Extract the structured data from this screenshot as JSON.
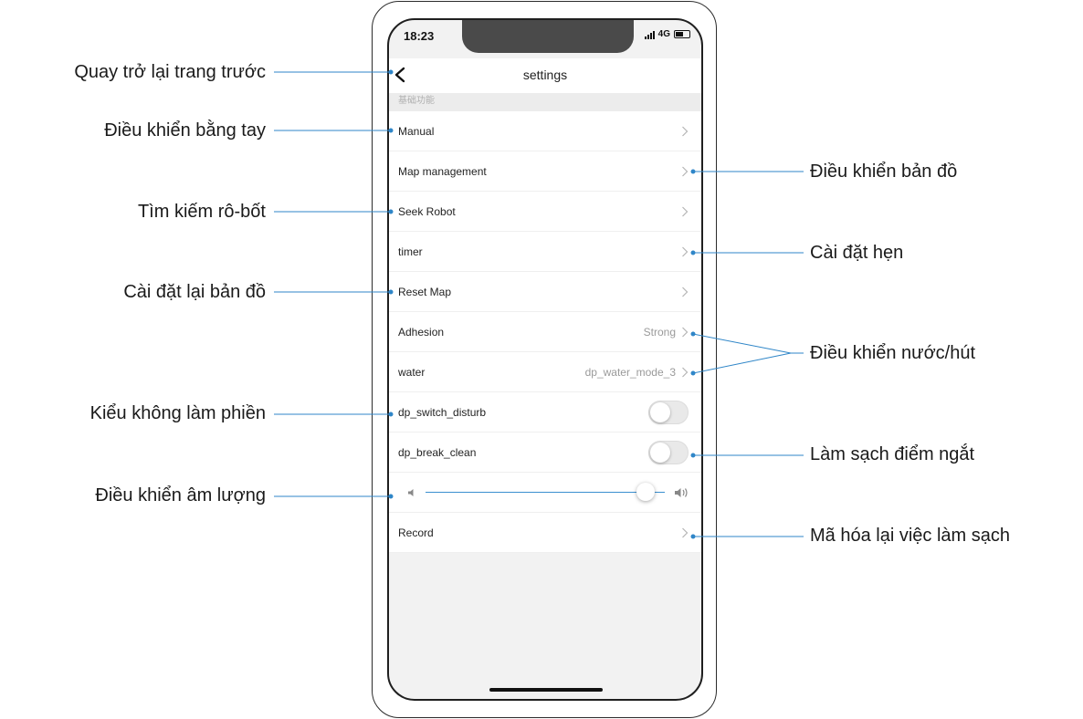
{
  "status_bar": {
    "time": "18:23",
    "network": "4G"
  },
  "header": {
    "title": "settings"
  },
  "section_label": "基础功能",
  "rows": [
    {
      "label": "Manual",
      "kind": "chevron"
    },
    {
      "label": "Map management",
      "kind": "chevron"
    },
    {
      "label": "Seek Robot",
      "kind": "chevron"
    },
    {
      "label": "timer",
      "kind": "chevron"
    },
    {
      "label": "Reset Map",
      "kind": "chevron"
    },
    {
      "label": "Adhesion",
      "value": "Strong",
      "kind": "chevron"
    },
    {
      "label": "water",
      "value": "dp_water_mode_3",
      "kind": "chevron"
    },
    {
      "label": "dp_switch_disturb",
      "kind": "toggle",
      "on": false
    },
    {
      "label": "dp_break_clean",
      "kind": "toggle",
      "on": false
    },
    {
      "kind": "slider",
      "level": 0.92
    },
    {
      "label": "Record",
      "kind": "chevron"
    }
  ],
  "annotations": {
    "back": "Quay trở lại trang trước",
    "manual": "Điều khiển bằng tay",
    "map_management": "Điều khiển bản đồ",
    "seek_robot": "Tìm kiếm rô-bốt",
    "timer": "Cài đặt hẹn",
    "reset_map": "Cài đặt lại bản đồ",
    "water_suction": "Điều khiển nước/hút",
    "do_not_disturb": "Kiểu không làm phiền",
    "break_clean": "Làm sạch điểm ngắt",
    "volume": "Điều khiển âm lượng",
    "record": "Mã hóa lại việc làm sạch"
  },
  "colors": {
    "leader": "#2f86c8",
    "dot": "#2f86c8"
  }
}
